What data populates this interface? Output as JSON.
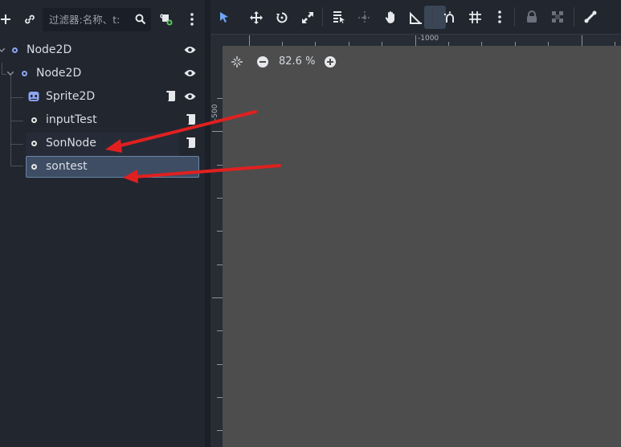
{
  "scene_dock": {
    "filter_placeholder": "过滤器:名称、t:",
    "tree": [
      {
        "label": "Node2D",
        "type": "Node2D"
      },
      {
        "label": "Node2D",
        "type": "Node2D"
      },
      {
        "label": "Sprite2D",
        "type": "Sprite2D"
      },
      {
        "label": "inputTest",
        "type": "Node"
      },
      {
        "label": "SonNode",
        "type": "Node"
      },
      {
        "label": "sontest",
        "type": "Node",
        "selected": true
      }
    ]
  },
  "viewport": {
    "zoom": "82.6 %",
    "ruler_top_label": "-1000",
    "ruler_left_label": "-500"
  },
  "colors": {
    "panel_bg": "#21262f",
    "canvas_bg": "#4d4d4d",
    "accent_blue": "#8da5f3",
    "selected_bg": "#3e4d63",
    "arrow_red": "#e02020"
  }
}
